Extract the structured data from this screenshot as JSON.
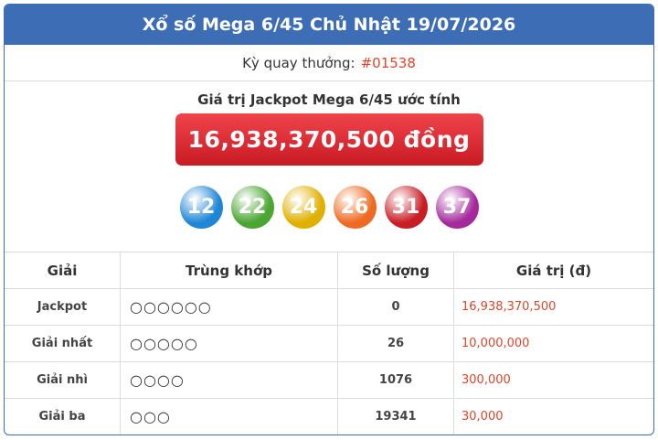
{
  "header": {
    "title": "Xổ số Mega 6/45 Chủ Nhật 19/07/2026"
  },
  "draw": {
    "label": "Kỳ quay thưởng:",
    "number": "#01538"
  },
  "jackpot": {
    "label": "Giá trị Jackpot Mega 6/45 ước tính",
    "amount": "16,938,370,500 đồng"
  },
  "balls": [
    {
      "value": "12",
      "color": "#1f86d6"
    },
    {
      "value": "22",
      "color": "#4aa532"
    },
    {
      "value": "24",
      "color": "#e0b000"
    },
    {
      "value": "26",
      "color": "#ee6a23"
    },
    {
      "value": "31",
      "color": "#c81d24"
    },
    {
      "value": "37",
      "color": "#a42a9c"
    }
  ],
  "table": {
    "headers": [
      "Giải",
      "Trùng khớp",
      "Số lượng",
      "Giá trị (đ)"
    ],
    "rows": [
      {
        "prize": "Jackpot",
        "match": "○○○○○○",
        "count": "0",
        "value": "16,938,370,500"
      },
      {
        "prize": "Giải nhất",
        "match": "○○○○○",
        "count": "26",
        "value": "10,000,000"
      },
      {
        "prize": "Giải nhì",
        "match": "○○○○",
        "count": "1076",
        "value": "300,000"
      },
      {
        "prize": "Giải ba",
        "match": "○○○",
        "count": "19341",
        "value": "30,000"
      }
    ]
  }
}
